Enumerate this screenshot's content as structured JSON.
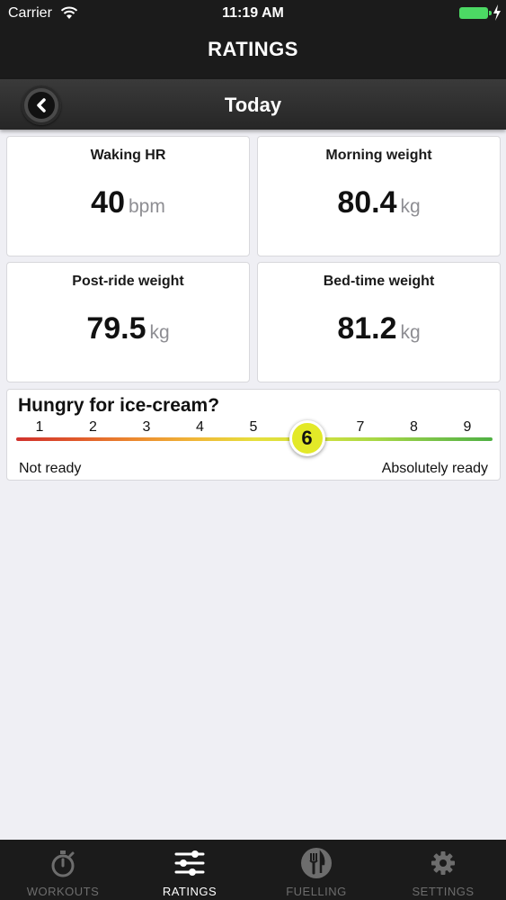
{
  "status_bar": {
    "carrier": "Carrier",
    "time": "11:19 AM",
    "battery_color": "#4cd964"
  },
  "header": {
    "title": "RATINGS",
    "subtitle": "Today",
    "back_icon": "chevron-left-icon"
  },
  "metrics": [
    {
      "label": "Waking HR",
      "value": "40",
      "unit": "bpm"
    },
    {
      "label": "Morning weight",
      "value": "80.4",
      "unit": "kg"
    },
    {
      "label": "Post-ride weight",
      "value": "79.5",
      "unit": "kg"
    },
    {
      "label": "Bed-time weight",
      "value": "81.2",
      "unit": "kg"
    }
  ],
  "rating": {
    "question": "Hungry for ice-cream?",
    "scale": [
      "1",
      "2",
      "3",
      "4",
      "5",
      "6",
      "7",
      "8",
      "9"
    ],
    "selected": "6",
    "min_label": "Not ready",
    "max_label": "Absolutely ready",
    "colors": [
      "#d0312d",
      "#e05a2b",
      "#ec8a2f",
      "#f0b838",
      "#e6df3c",
      "#d3e13e",
      "#a9d845",
      "#78c248",
      "#4fb043"
    ]
  },
  "tabbar": {
    "active": "RATINGS",
    "tabs": [
      {
        "label": "WORKOUTS",
        "icon": "stopwatch-icon"
      },
      {
        "label": "RATINGS",
        "icon": "sliders-icon"
      },
      {
        "label": "FUELLING",
        "icon": "fork-knife-icon"
      },
      {
        "label": "SETTINGS",
        "icon": "gear-icon"
      }
    ]
  }
}
